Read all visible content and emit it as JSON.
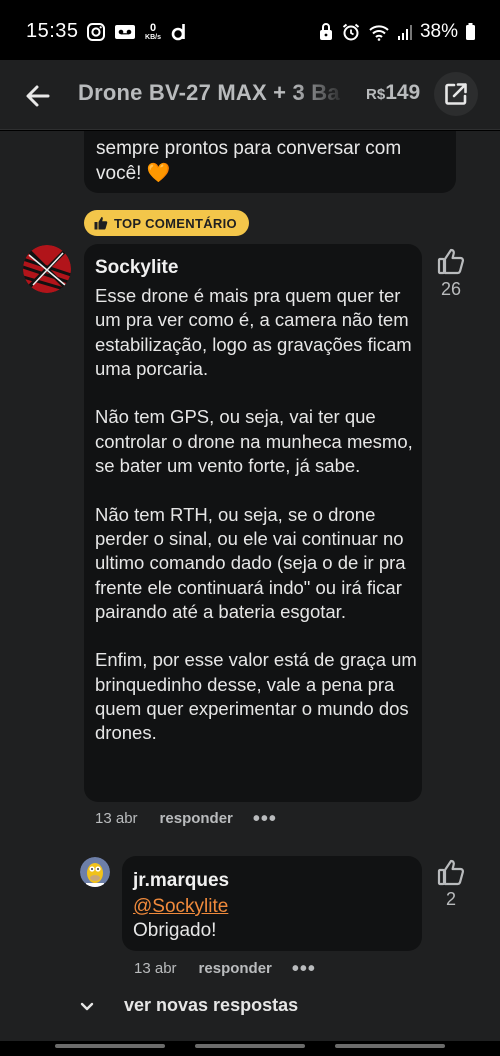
{
  "status_bar": {
    "time": "15:35",
    "net_speed_value": "0",
    "net_speed_unit": "KB/s",
    "battery": "38%"
  },
  "header": {
    "title": "Drone BV-27 MAX + 3 Ba",
    "currency": "R$",
    "price": "149",
    "back_icon": "arrow-left-icon",
    "external_icon": "open-external-icon"
  },
  "previous_comment": {
    "text_line1": "sempre prontos para conversar com",
    "text_line2": "você! 🧡"
  },
  "top_comment": {
    "badge_label": "TOP COMENTÁRIO",
    "author": "Sockylite",
    "paragraphs": [
      "Esse drone é mais pra quem quer ter um pra ver como é, a camera não tem estabilização, logo as gravações ficam uma porcaria.",
      "Não tem GPS, ou seja, vai ter que controlar o drone na munheca mesmo, se bater um vento forte, já sabe.",
      "Não tem RTH, ou seja, se o drone perder o sinal, ou ele vai continuar no ultimo comando dado (seja o de ir pra frente ele continuará indo\" ou irá ficar pairando até a bateria esgotar.",
      "Enfim, por esse valor está de graça um brinquedinho desse, vale a pena pra quem quer experimentar o mundo dos drones."
    ],
    "likes": "26",
    "date": "13 abr",
    "reply_label": "responder",
    "more_label": "•••"
  },
  "reply": {
    "author": "jr.marques",
    "mention": "@Sockylite",
    "text": "Obrigado!",
    "likes": "2",
    "date": "13 abr",
    "reply_label": "responder",
    "more_label": "•••"
  },
  "more_replies_label": "ver novas respostas",
  "colors": {
    "background": "#1f2021",
    "bubble": "#111213",
    "badge": "#f3c64a",
    "mention": "#f08a3c"
  }
}
